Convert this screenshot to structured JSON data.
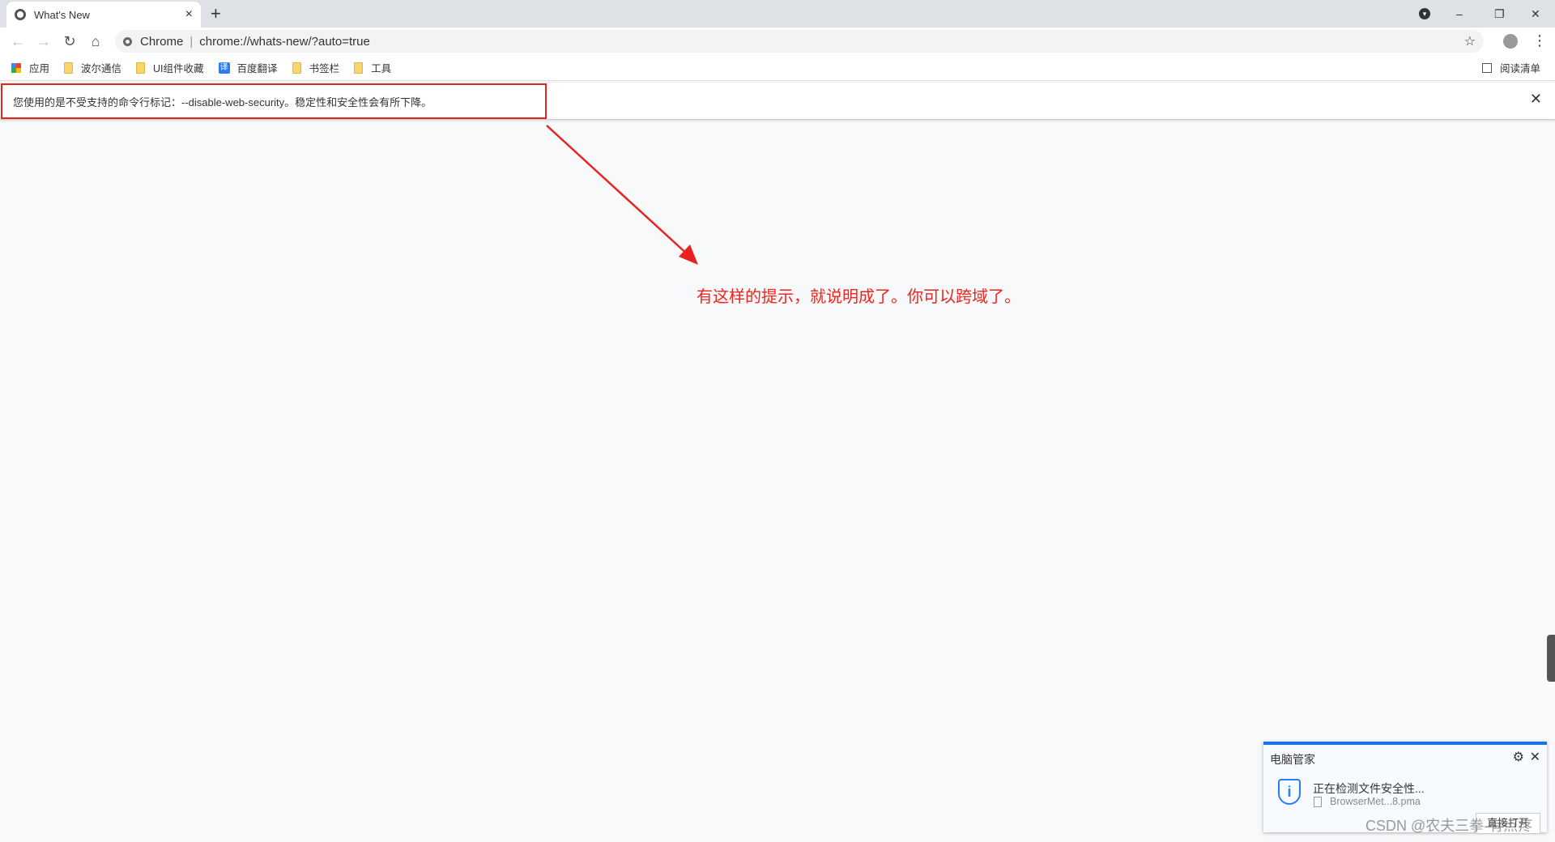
{
  "tab": {
    "title": "What's New",
    "close": "×",
    "new_tab": "+"
  },
  "window": {
    "profile_icon": "▾",
    "minimize": "–",
    "restore": "❐",
    "close": "✕"
  },
  "toolbar": {
    "back": "←",
    "forward": "→",
    "reload": "↻",
    "home": "⌂",
    "site_label": "Chrome",
    "url": "chrome://whats-new/?auto=true",
    "star": "☆",
    "menu": "⋮"
  },
  "bookmarks": {
    "items": [
      {
        "label": "应用",
        "icon": "apps-grid"
      },
      {
        "label": "波尔通信",
        "icon": "folder"
      },
      {
        "label": "UI组件收藏",
        "icon": "folder"
      },
      {
        "label": "百度翻译",
        "icon": "translate"
      },
      {
        "label": "书签栏",
        "icon": "folder"
      },
      {
        "label": "工具",
        "icon": "folder"
      }
    ],
    "reading_list": "阅读清单"
  },
  "infobar": {
    "message": "您使用的是不受支持的命令行标记：--disable-web-security。稳定性和安全性会有所下降。",
    "close": "✕"
  },
  "annotation": {
    "text": "有这样的提示，就说明成了。你可以跨域了。",
    "color": "#f2231b"
  },
  "popup": {
    "title": "电脑管家",
    "status": "正在检测文件安全性...",
    "filename": "BrowserMet...8.pma",
    "button": "直接打开",
    "accent": "#1a73e8"
  },
  "watermark": "CSDN @农夫三拳-有点疼"
}
